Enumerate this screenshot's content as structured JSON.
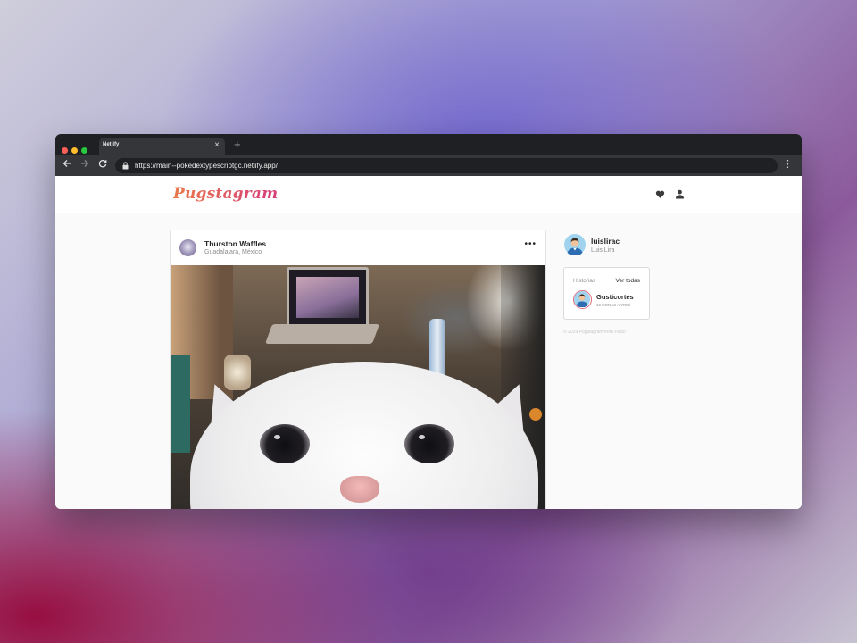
{
  "browser": {
    "tab_title": "Netlify",
    "tab_close": "×",
    "new_tab": "+",
    "url": "https://main--pokedextypescriptgc.netlify.app/",
    "icons": [
      "back-arrow-icon",
      "forward-arrow-icon",
      "reload-icon",
      "lock-icon",
      "kebab-menu-icon"
    ]
  },
  "app": {
    "logo": "Pugstagram",
    "header_icons": [
      "heart-icon",
      "user-icon"
    ]
  },
  "post": {
    "username": "Thurston Waffles",
    "location": "Guadalajara, México",
    "more_label": "•••"
  },
  "sidebar": {
    "username": "luislirac",
    "fullname": "Luis Lira",
    "stories": {
      "title": "Historias",
      "see_all": "Ver todas",
      "item": {
        "username": "Gusticortes",
        "time": "10 HORAS ANTES"
      }
    },
    "footer": "© 2019 Pugstagram from Platzi"
  },
  "colors": {
    "logo_gradient": [
      "#e9794a",
      "#d63d7b"
    ],
    "story_ring": "#e06b7d",
    "browser_dark": "#1f2023"
  }
}
